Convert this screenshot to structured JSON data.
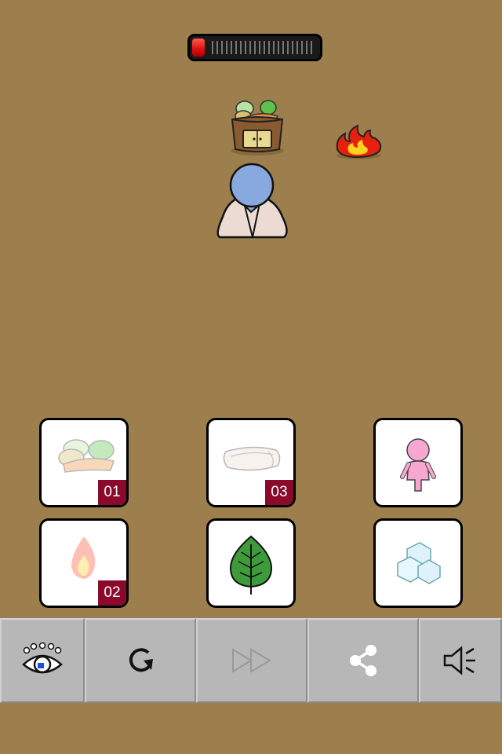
{
  "timer": {
    "progress": 0.1,
    "color": "#e00f0f"
  },
  "scene": {
    "character": {
      "icon": "bald-person-icon",
      "color": "#88a8e0"
    },
    "basket": {
      "icon": "vegetable-basket-icon"
    },
    "campfire": {
      "icon": "campfire-icon"
    }
  },
  "items": [
    {
      "icon": "vegetables-icon",
      "badge": "01",
      "used": true
    },
    {
      "icon": "blanket-icon",
      "badge": "03",
      "used": true
    },
    {
      "icon": "pink-doll-icon",
      "badge": "",
      "used": false
    },
    {
      "icon": "fire-icon",
      "badge": "02",
      "used": true
    },
    {
      "icon": "leaf-icon",
      "badge": "",
      "used": false
    },
    {
      "icon": "ice-cubes-icon",
      "badge": "",
      "used": false
    }
  ],
  "toolbar": {
    "buttons": [
      {
        "icon": "hint-eye-icon"
      },
      {
        "icon": "restart-icon"
      },
      {
        "icon": "skip-forward-icon",
        "enabled": false
      },
      {
        "icon": "share-icon"
      },
      {
        "icon": "sound-icon"
      }
    ]
  },
  "colors": {
    "background": "#9c7f4c",
    "badge": "#8b0a2c",
    "toolbar": "#b7b7b7"
  }
}
